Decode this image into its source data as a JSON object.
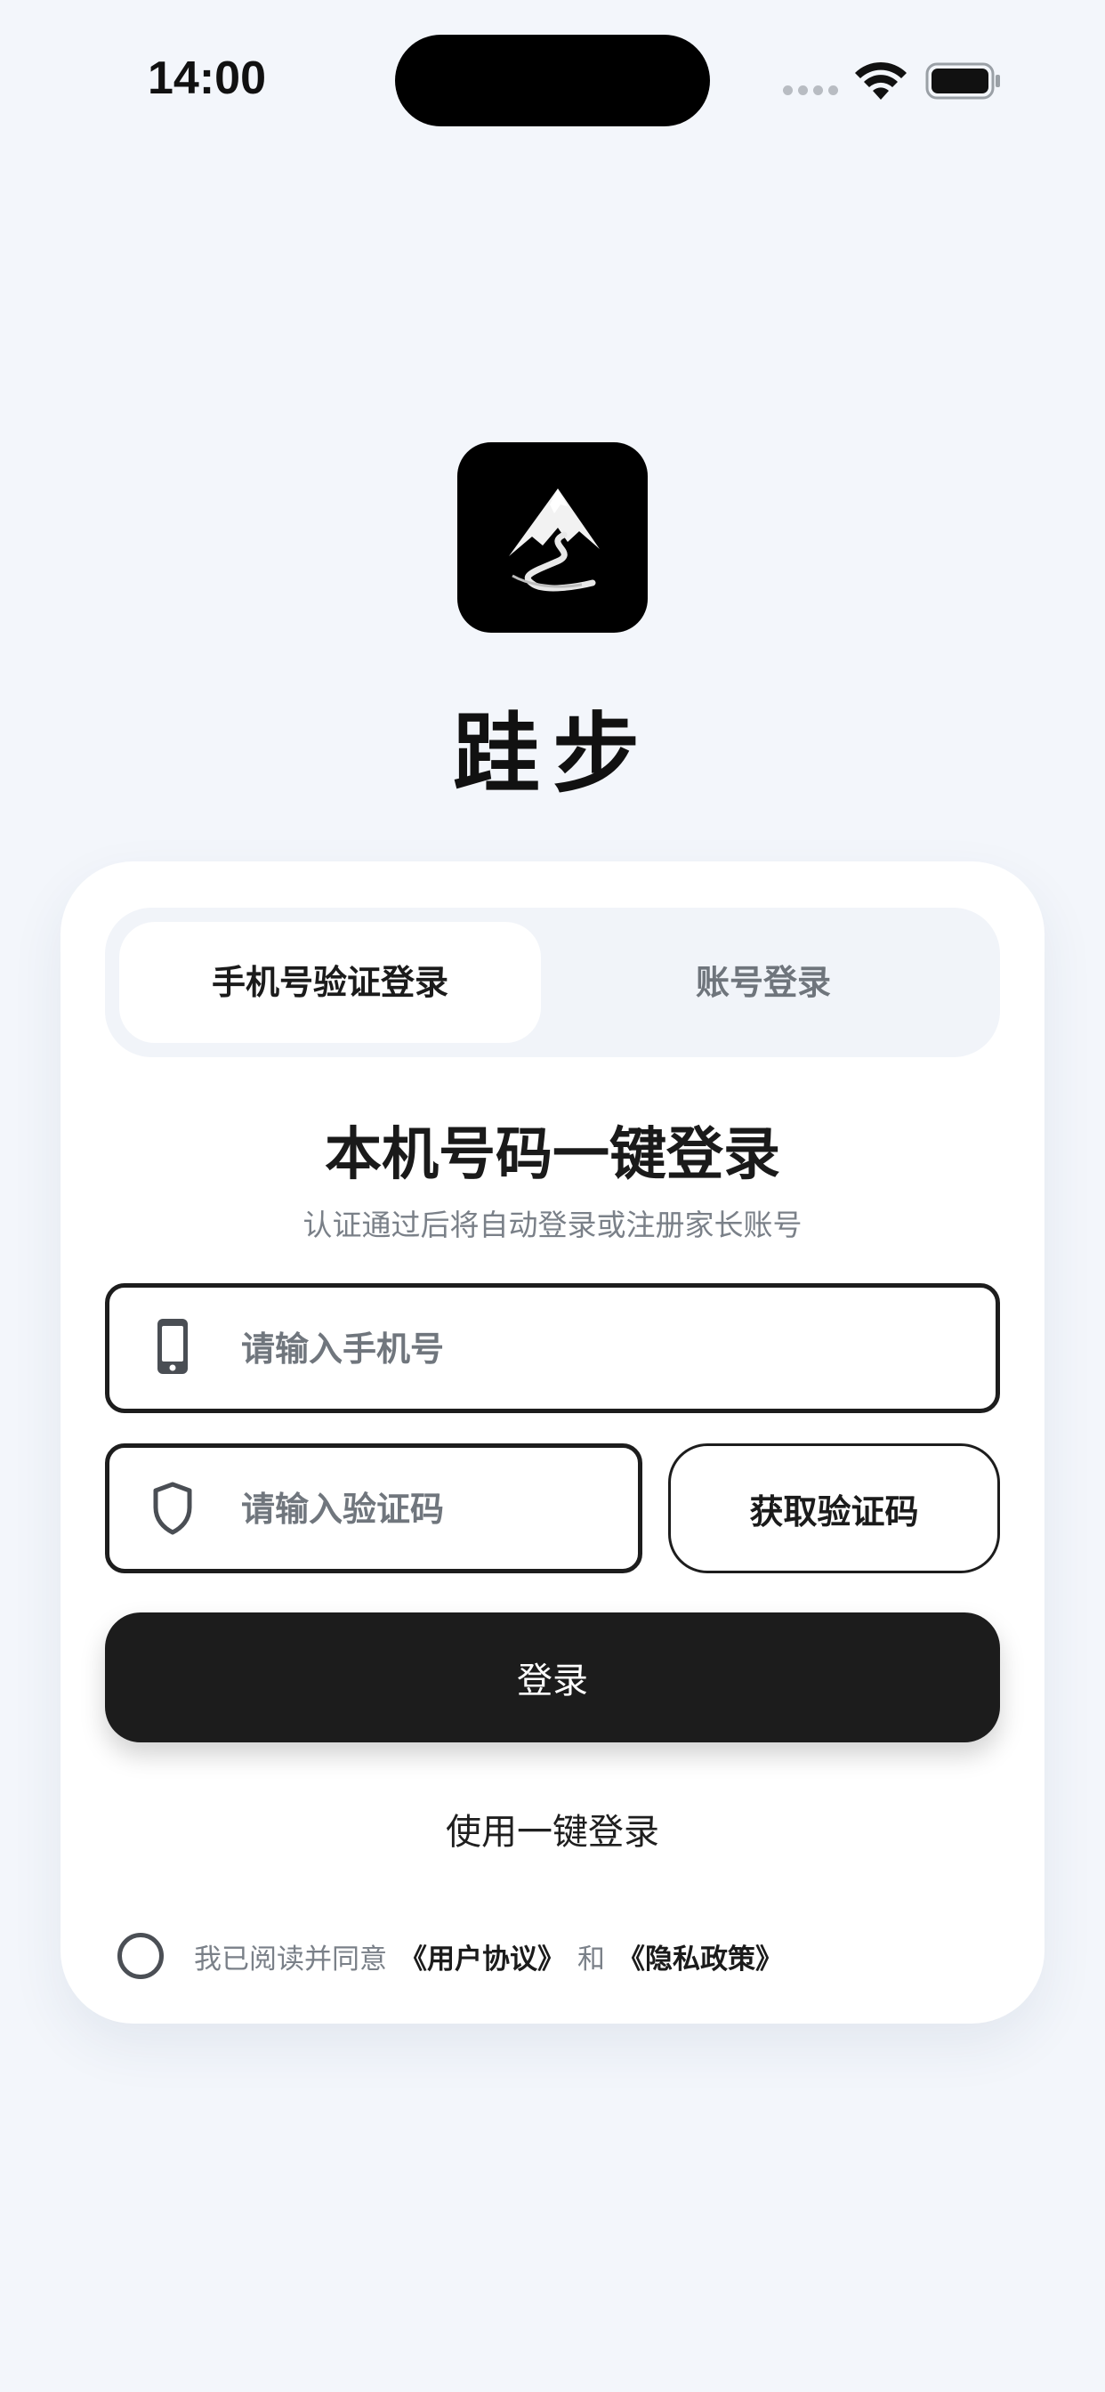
{
  "status_bar": {
    "time": "14:00"
  },
  "app": {
    "name": "跬步",
    "logo_icon": "mountain-road-logo"
  },
  "tabs": [
    {
      "label": "手机号验证登录",
      "active": true
    },
    {
      "label": "账号登录",
      "active": false
    }
  ],
  "form": {
    "heading": "本机号码一键登录",
    "subheading": "认证通过后将自动登录或注册家长账号",
    "phone_placeholder": "请输入手机号",
    "phone_icon": "phone-icon",
    "code_placeholder": "请输入验证码",
    "code_icon": "shield-icon",
    "get_code_label": "获取验证码",
    "login_label": "登录",
    "one_click_label": "使用一键登录"
  },
  "agreement": {
    "prefix": "我已阅读并同意",
    "user_agreement": "《用户协议》",
    "conjunction": "和",
    "privacy_policy": "《隐私政策》",
    "checked": false
  },
  "colors": {
    "background": "#f3f6fb",
    "primary": "#1c1c1c",
    "card": "#ffffff",
    "muted_text": "#7a8088"
  }
}
